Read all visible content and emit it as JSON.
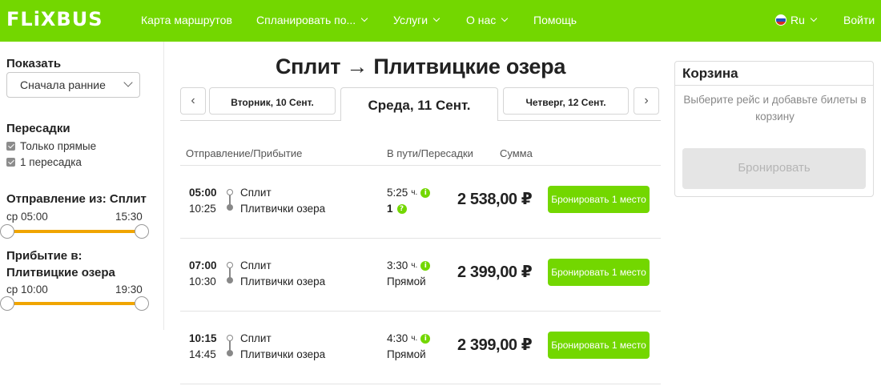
{
  "header": {
    "logo": "FLiXBUS",
    "nav": [
      "Карта маршрутов",
      "Спланировать по...",
      "Услуги",
      "О нас",
      "Помощь"
    ],
    "language": "Ru",
    "login": "Войти"
  },
  "sidebar": {
    "sort_label": "Показать",
    "sort_value": "Сначала ранние",
    "transfers_label": "Пересадки",
    "transfers_options": [
      "Только прямые",
      "1 пересадка"
    ],
    "departure_label": "Отправление из: Сплит",
    "departure_min": "ср 05:00",
    "departure_max": "15:30",
    "arrival_label_line1": "Прибытие в:",
    "arrival_label_line2": "Плитвицкие озера",
    "arrival_min": "ср 10:00",
    "arrival_max": "19:30"
  },
  "main": {
    "route_title": "Сплит → Плитвицкие озера",
    "prev_arrow": "‹",
    "next_arrow": "›",
    "dates": [
      "Вторник, 10 Сент.",
      "Среда, 11 Сент.",
      "Четверг, 12 Сент."
    ],
    "columns": [
      "Отправление/Прибытие",
      "В пути/Пересадки",
      "Сумма"
    ],
    "rides": [
      {
        "dep": "05:00",
        "arr": "10:25",
        "from": "Сплит",
        "to": "Плитвички озера",
        "duration": "5:25",
        "duration_unit": "ч.",
        "transfers": "1",
        "price": "2 538,00 ₽",
        "button": "Бронировать 1 место"
      },
      {
        "dep": "07:00",
        "arr": "10:30",
        "from": "Сплит",
        "to": "Плитвички озера",
        "duration": "3:30",
        "duration_unit": "ч.",
        "transfers": "Прямой",
        "price": "2 399,00 ₽",
        "button": "Бронировать 1 место"
      },
      {
        "dep": "10:15",
        "arr": "14:45",
        "from": "Сплит",
        "to": "Плитвички озера",
        "duration": "4:30",
        "duration_unit": "ч.",
        "transfers": "Прямой",
        "price": "2 399,00 ₽",
        "button": "Бронировать 1 место"
      }
    ]
  },
  "cart": {
    "title": "Корзина",
    "text": "Выберите рейс и добавьте билеты в корзину",
    "button": "Бронировать"
  },
  "colors": {
    "brand": "#73d700",
    "slider": "#f0a500"
  }
}
